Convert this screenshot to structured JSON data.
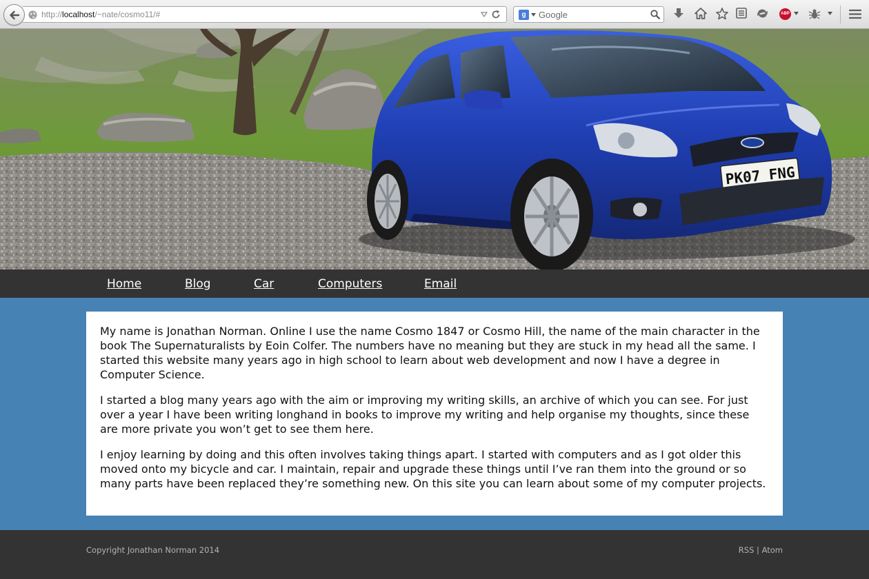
{
  "browser": {
    "url_scheme": "http://",
    "url_host": "localhost",
    "url_path": "/~nate/cosmo11/#",
    "search_placeholder": "Google",
    "search_engine_glyph": "g",
    "adblock_label": "ABP"
  },
  "header": {
    "license_plate": "PK07 FNG"
  },
  "nav": {
    "items": [
      {
        "label": "Home"
      },
      {
        "label": "Blog"
      },
      {
        "label": "Car"
      },
      {
        "label": "Computers"
      },
      {
        "label": "Email"
      }
    ]
  },
  "content": {
    "paragraphs": [
      "My name is Jonathan Norman. Online I use the name Cosmo 1847 or Cosmo Hill, the name of the main character in the book The Supernaturalists by Eoin Colfer. The numbers have no meaning but they are stuck in my head all the same. I started this website many years ago in high school to learn about web development and now I have a degree in Computer Science.",
      "I started a blog many years ago with the aim or improving my writing skills, an archive of which you can see. For just over a year I have been writing longhand in books to improve my writing and help organise my thoughts, since these are more private you won’t get to see them here.",
      "I enjoy learning by doing and this often involves taking things apart. I started with computers and as I got older this moved onto my bicycle and car. I maintain, repair and upgrade these things until I’ve ran them into the ground or so many parts have been replaced they’re something new. On this site you can learn about some of my computer projects."
    ]
  },
  "footer": {
    "copyright": "Copyright Jonathan Norman 2014",
    "rss": "RSS",
    "separator": "|",
    "atom": "Atom"
  },
  "colors": {
    "page_background": "#4682b4",
    "bar_background": "#333333",
    "car_blue": "#1f3fb3"
  }
}
